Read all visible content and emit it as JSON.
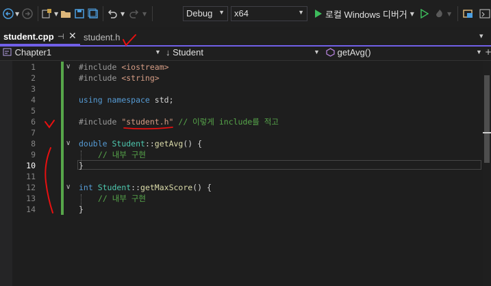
{
  "toolbar": {
    "config": "Debug",
    "platform": "x64",
    "run_label": "로컬 Windows 디버거"
  },
  "tabs": [
    {
      "label": "student.cpp",
      "active": true
    },
    {
      "label": "student.h",
      "active": false
    }
  ],
  "nav": {
    "project": "Chapter1",
    "scope": "Student",
    "member": "getAvg()"
  },
  "line_numbers": [
    "1",
    "2",
    "3",
    "4",
    "5",
    "6",
    "7",
    "8",
    "9",
    "10",
    "11",
    "12",
    "13",
    "14"
  ],
  "current_line": "10",
  "code": {
    "l1_a": "#include ",
    "l1_b": "<iostream>",
    "l2_a": "#include ",
    "l2_b": "<string>",
    "l4_a": "using",
    "l4_b": " namespace",
    "l4_c": " std;",
    "l6_a": "#include ",
    "l6_b": "\"student.h\"",
    "l6_c": " // 이렇게 include를 적고",
    "l8_a": "double",
    "l8_b": " Student",
    "l8_c": "::",
    "l8_d": "getAvg",
    "l8_e": "() {",
    "l9": "// 내부 구현",
    "l10": "}",
    "l12_a": "int",
    "l12_b": " Student",
    "l12_c": "::",
    "l12_d": "getMaxScore",
    "l12_e": "() {",
    "l13": "// 내부 구현",
    "l14": "}"
  },
  "colors": {
    "accent": "#7160e8",
    "annotation": "#e81010",
    "change_bar": "#57a64a"
  }
}
